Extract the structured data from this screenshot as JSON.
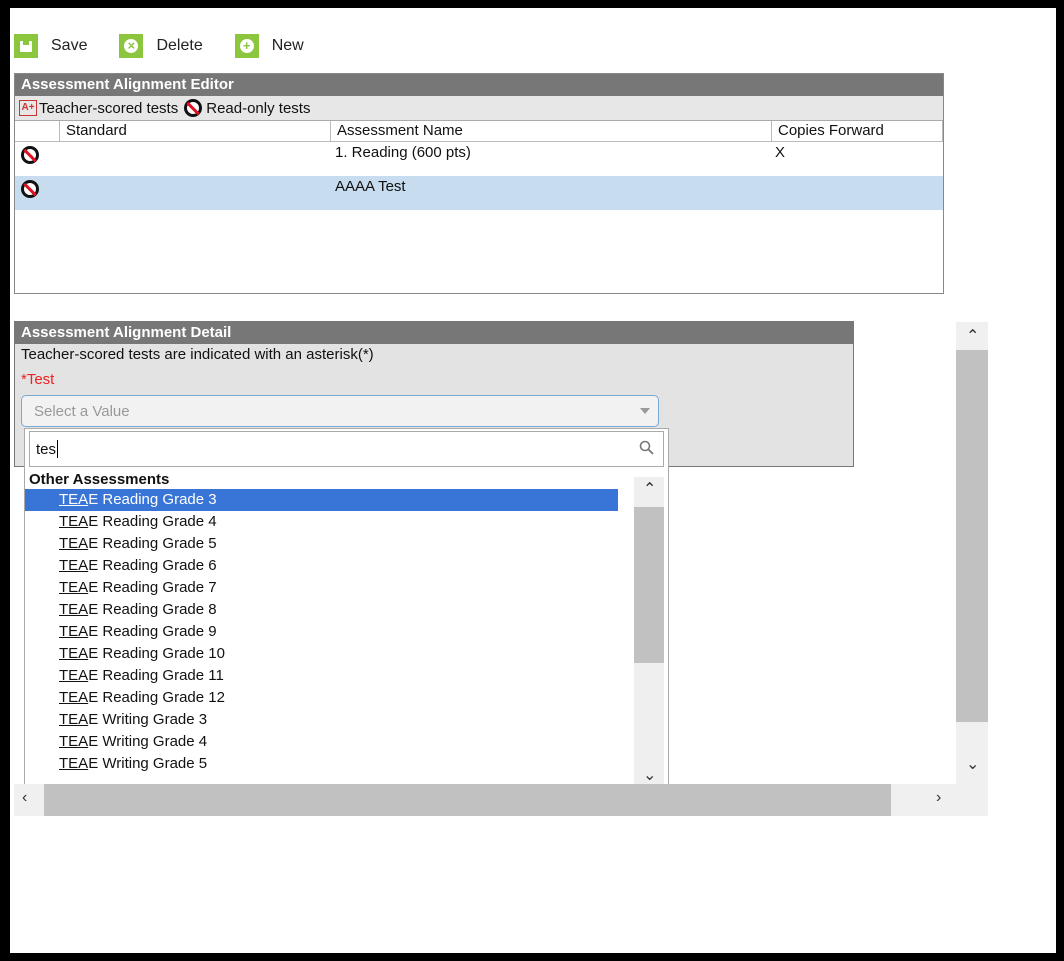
{
  "toolbar": {
    "save": "Save",
    "delete": "Delete",
    "new": "New"
  },
  "editor": {
    "title": "Assessment Alignment Editor",
    "legend_teacher": "Teacher-scored tests",
    "legend_readonly": "Read-only tests",
    "columns": [
      "Standard",
      "Assessment Name",
      "Copies Forward"
    ],
    "rows": [
      {
        "standard": "",
        "name": "1. Reading (600 pts)",
        "copies": "X"
      },
      {
        "standard": "",
        "name": "AAAA Test",
        "copies": ""
      }
    ]
  },
  "detail": {
    "title": "Assessment Alignment Detail",
    "note": "Teacher-scored tests are indicated with an asterisk(*)",
    "field_label": "*Test",
    "select_placeholder": "Select a Value",
    "search_value": "tes",
    "group": "Other Assessments",
    "options": [
      {
        "match": "TEA",
        "rest": "E Reading Grade 3"
      },
      {
        "match": "TEA",
        "rest": "E Reading Grade 4"
      },
      {
        "match": "TEA",
        "rest": "E Reading Grade 5"
      },
      {
        "match": "TEA",
        "rest": "E Reading Grade 6"
      },
      {
        "match": "TEA",
        "rest": "E Reading Grade 7"
      },
      {
        "match": "TEA",
        "rest": "E Reading Grade 8"
      },
      {
        "match": "TEA",
        "rest": "E Reading Grade 9"
      },
      {
        "match": "TEA",
        "rest": "E Reading Grade 10"
      },
      {
        "match": "TEA",
        "rest": "E Reading Grade 11"
      },
      {
        "match": "TEA",
        "rest": "E Reading Grade 12"
      },
      {
        "match": "TEA",
        "rest": "E Writing Grade 3"
      },
      {
        "match": "TEA",
        "rest": "E Writing Grade 4"
      },
      {
        "match": "TEA",
        "rest": "E Writing Grade 5"
      }
    ]
  }
}
